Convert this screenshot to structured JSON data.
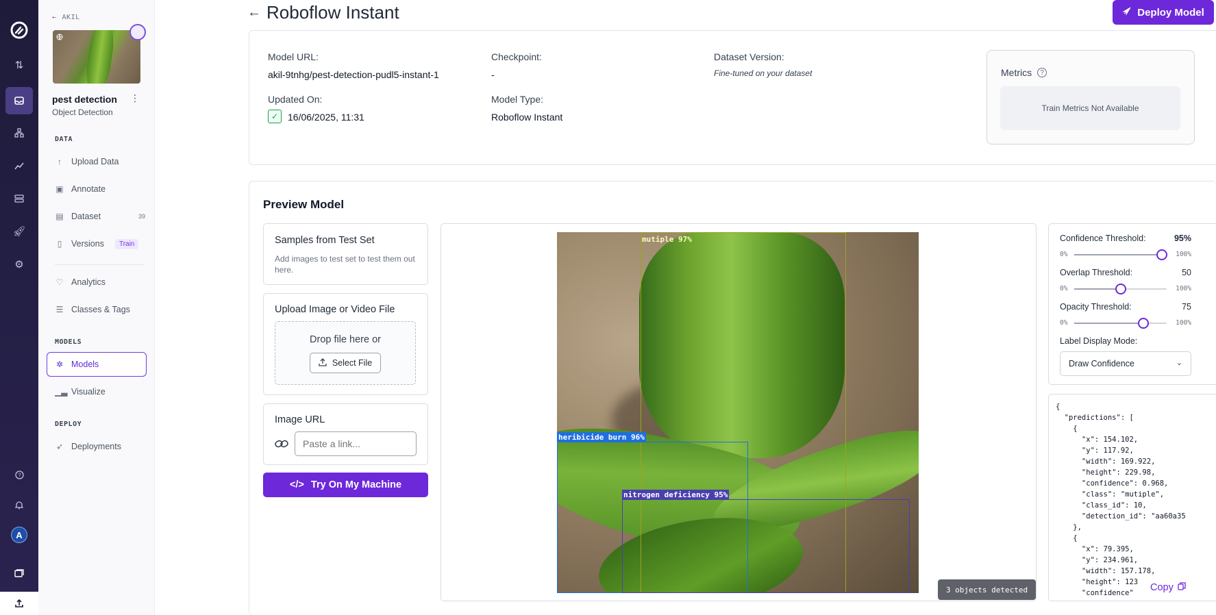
{
  "rail": {
    "icons": [
      "roboflow-logo",
      "swap-icon",
      "inbox-icon",
      "workflow-icon",
      "chart-icon",
      "database-icon",
      "rocket-icon",
      "settings-icon",
      "help-icon",
      "bell-icon",
      "avatar",
      "docs-icon",
      "upload-icon"
    ],
    "avatar_letter": "A"
  },
  "sidenav": {
    "back_label": "AKIL",
    "project_name": "pest detection",
    "project_type": "Object Detection",
    "sections": {
      "data": "DATA",
      "models": "MODELS",
      "deploy": "DEPLOY"
    },
    "items": {
      "upload": "Upload Data",
      "annotate": "Annotate",
      "dataset": "Dataset",
      "dataset_count": "39",
      "versions": "Versions",
      "versions_badge": "Train",
      "analytics": "Analytics",
      "classes": "Classes & Tags",
      "models": "Models",
      "visualize": "Visualize",
      "deployments": "Deployments"
    }
  },
  "header": {
    "title": "Roboflow Instant",
    "deploy_label": "Deploy Model"
  },
  "model_info": {
    "model_url_label": "Model URL:",
    "model_url": "akil-9tnhg/pest-detection-pudl5-instant-1",
    "checkpoint_label": "Checkpoint:",
    "checkpoint": "-",
    "dataset_version_label": "Dataset Version:",
    "dataset_version": "Fine-tuned on your dataset",
    "updated_label": "Updated On:",
    "updated": "16/06/2025, 11:31",
    "model_type_label": "Model Type:",
    "model_type": "Roboflow Instant",
    "metrics_title": "Metrics",
    "metrics_empty": "Train Metrics Not Available"
  },
  "preview": {
    "title": "Preview Model",
    "samples_title": "Samples from Test Set",
    "samples_text": "Add images to test set to test them out here.",
    "upload_title": "Upload Image or Video File",
    "drop_text": "Drop file here or",
    "select_file": "Select File",
    "image_url_title": "Image URL",
    "image_url_placeholder": "Paste a link...",
    "try_label": "Try On My Machine",
    "detections": [
      {
        "label": "mutiple 97%",
        "color": "#9aa41f"
      },
      {
        "label": "heribicide burn 96%",
        "color": "#1f6fe0"
      },
      {
        "label": "nitrogen deficiency 95%",
        "color": "#4a3fae"
      }
    ],
    "objects_detected": "3 objects detected"
  },
  "controls": {
    "confidence_label": "Confidence Threshold:",
    "confidence_value": "95%",
    "confidence_level": 95,
    "overlap_label": "Overlap Threshold:",
    "overlap_value": "50",
    "overlap_level": 50,
    "opacity_label": "Opacity Threshold:",
    "opacity_value": "75",
    "opacity_level": 75,
    "min_label": "0%",
    "max_label": "100%",
    "label_mode_label": "Label Display Mode:",
    "label_mode_value": "Draw Confidence"
  },
  "json_output": {
    "text": "{\n  \"predictions\": [\n    {\n      \"x\": 154.102,\n      \"y\": 117.92,\n      \"width\": 169.922,\n      \"height\": 229.98,\n      \"confidence\": 0.968,\n      \"class\": \"mutiple\",\n      \"class_id\": 10,\n      \"detection_id\": \"aa60a35\n    },\n    {\n      \"x\": 79.395,\n      \"y\": 234.961,\n      \"width\": 157.178,\n      \"height\": 123\n      \"confidence\"",
    "copy_label": "Copy"
  }
}
